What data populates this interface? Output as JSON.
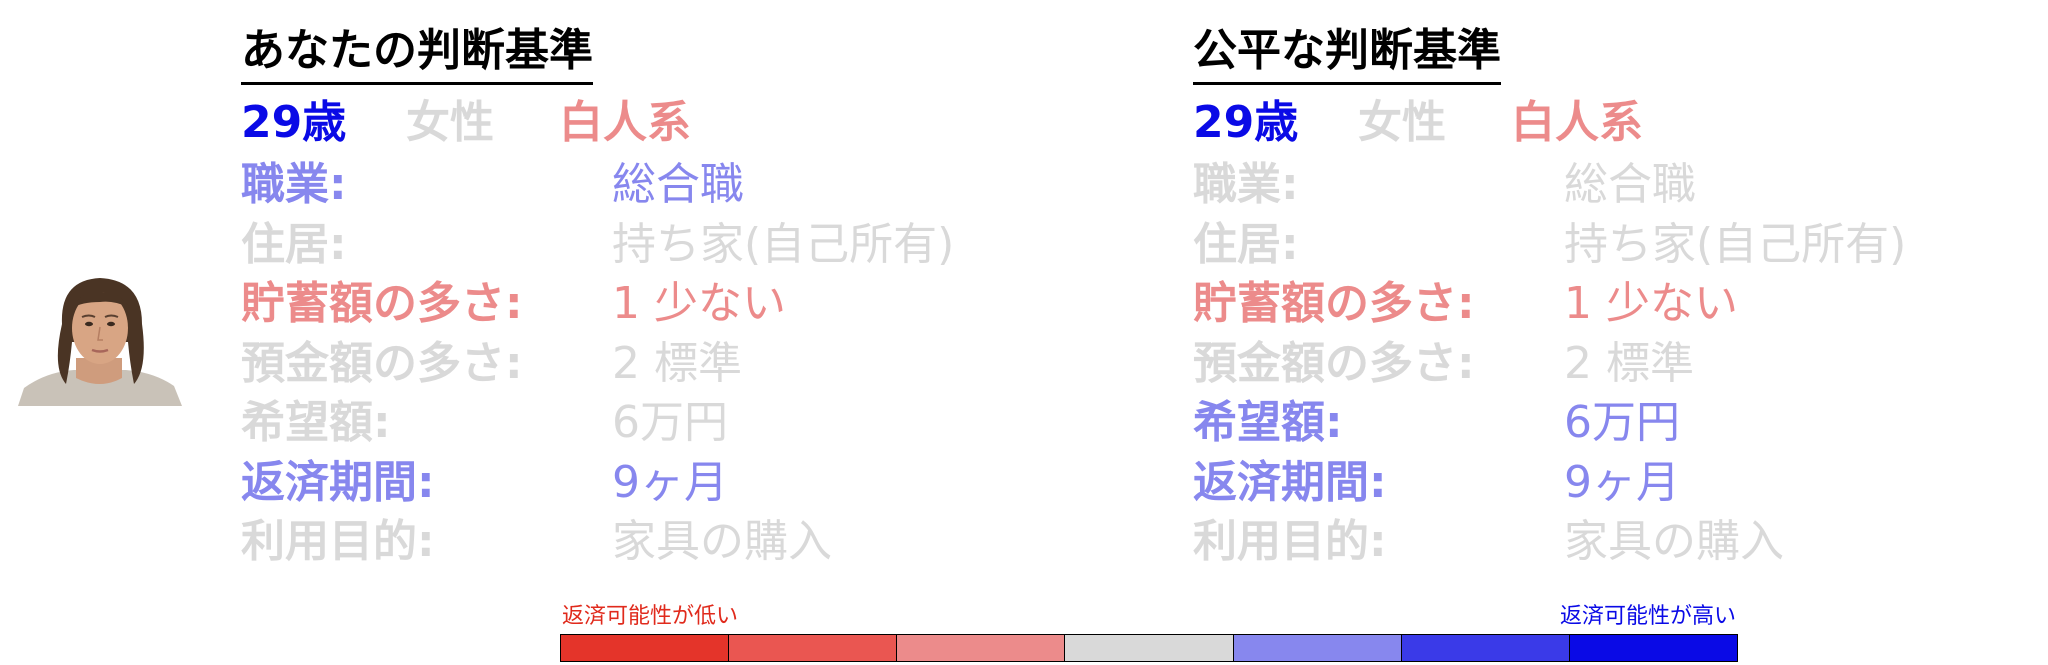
{
  "colors": {
    "strong_blue": "#0a0ae6",
    "light_blue": "#8787ee",
    "light_red": "#ec8b8b",
    "gray": "#d9d9d9",
    "black": "#000000"
  },
  "person": {
    "avatar": "portrait-photo"
  },
  "panels": [
    {
      "title": "あなたの判断基準",
      "demographics": {
        "age": {
          "text": "29歳",
          "color": "#0a0ae6"
        },
        "gender": {
          "text": "女性",
          "color": "#d9d9d9"
        },
        "race": {
          "text": "白人系",
          "color": "#ec8b8b"
        }
      },
      "rows": [
        {
          "label": "職業:",
          "value": "総合職",
          "color": "#8787ee"
        },
        {
          "label": "住居:",
          "value": "持ち家(自己所有)",
          "color": "#d9d9d9"
        },
        {
          "label": "貯蓄額の多さ:",
          "value": "1 少ない",
          "color": "#ec8b8b"
        },
        {
          "label": "預金額の多さ:",
          "value": "2 標準",
          "color": "#d9d9d9"
        },
        {
          "label": "希望額:",
          "value": "6万円",
          "color": "#d9d9d9"
        },
        {
          "label": "返済期間:",
          "value": "9ヶ月",
          "color": "#8787ee"
        },
        {
          "label": "利用目的:",
          "value": "家具の購入",
          "color": "#d9d9d9"
        }
      ]
    },
    {
      "title": "公平な判断基準",
      "demographics": {
        "age": {
          "text": "29歳",
          "color": "#0a0ae6"
        },
        "gender": {
          "text": "女性",
          "color": "#d9d9d9"
        },
        "race": {
          "text": "白人系",
          "color": "#ec8b8b"
        }
      },
      "rows": [
        {
          "label": "職業:",
          "value": "総合職",
          "color": "#d9d9d9"
        },
        {
          "label": "住居:",
          "value": "持ち家(自己所有)",
          "color": "#d9d9d9"
        },
        {
          "label": "貯蓄額の多さ:",
          "value": "1 少ない",
          "color": "#ec8b8b"
        },
        {
          "label": "預金額の多さ:",
          "value": "2 標準",
          "color": "#d9d9d9"
        },
        {
          "label": "希望額:",
          "value": "6万円",
          "color": "#8787ee"
        },
        {
          "label": "返済期間:",
          "value": "9ヶ月",
          "color": "#8787ee"
        },
        {
          "label": "利用目的:",
          "value": "家具の購入",
          "color": "#d9d9d9"
        }
      ]
    }
  ],
  "legend": {
    "low_label": "返済可能性が低い",
    "high_label": "返済可能性が高い",
    "low_color": "#e02a1c",
    "high_color": "#0a0ae6",
    "scale_colors": [
      "#e4342a",
      "#ea5651",
      "#ec8b8b",
      "#d9d9d9",
      "#8787ee",
      "#3a3ae8",
      "#0a0ae6"
    ]
  }
}
